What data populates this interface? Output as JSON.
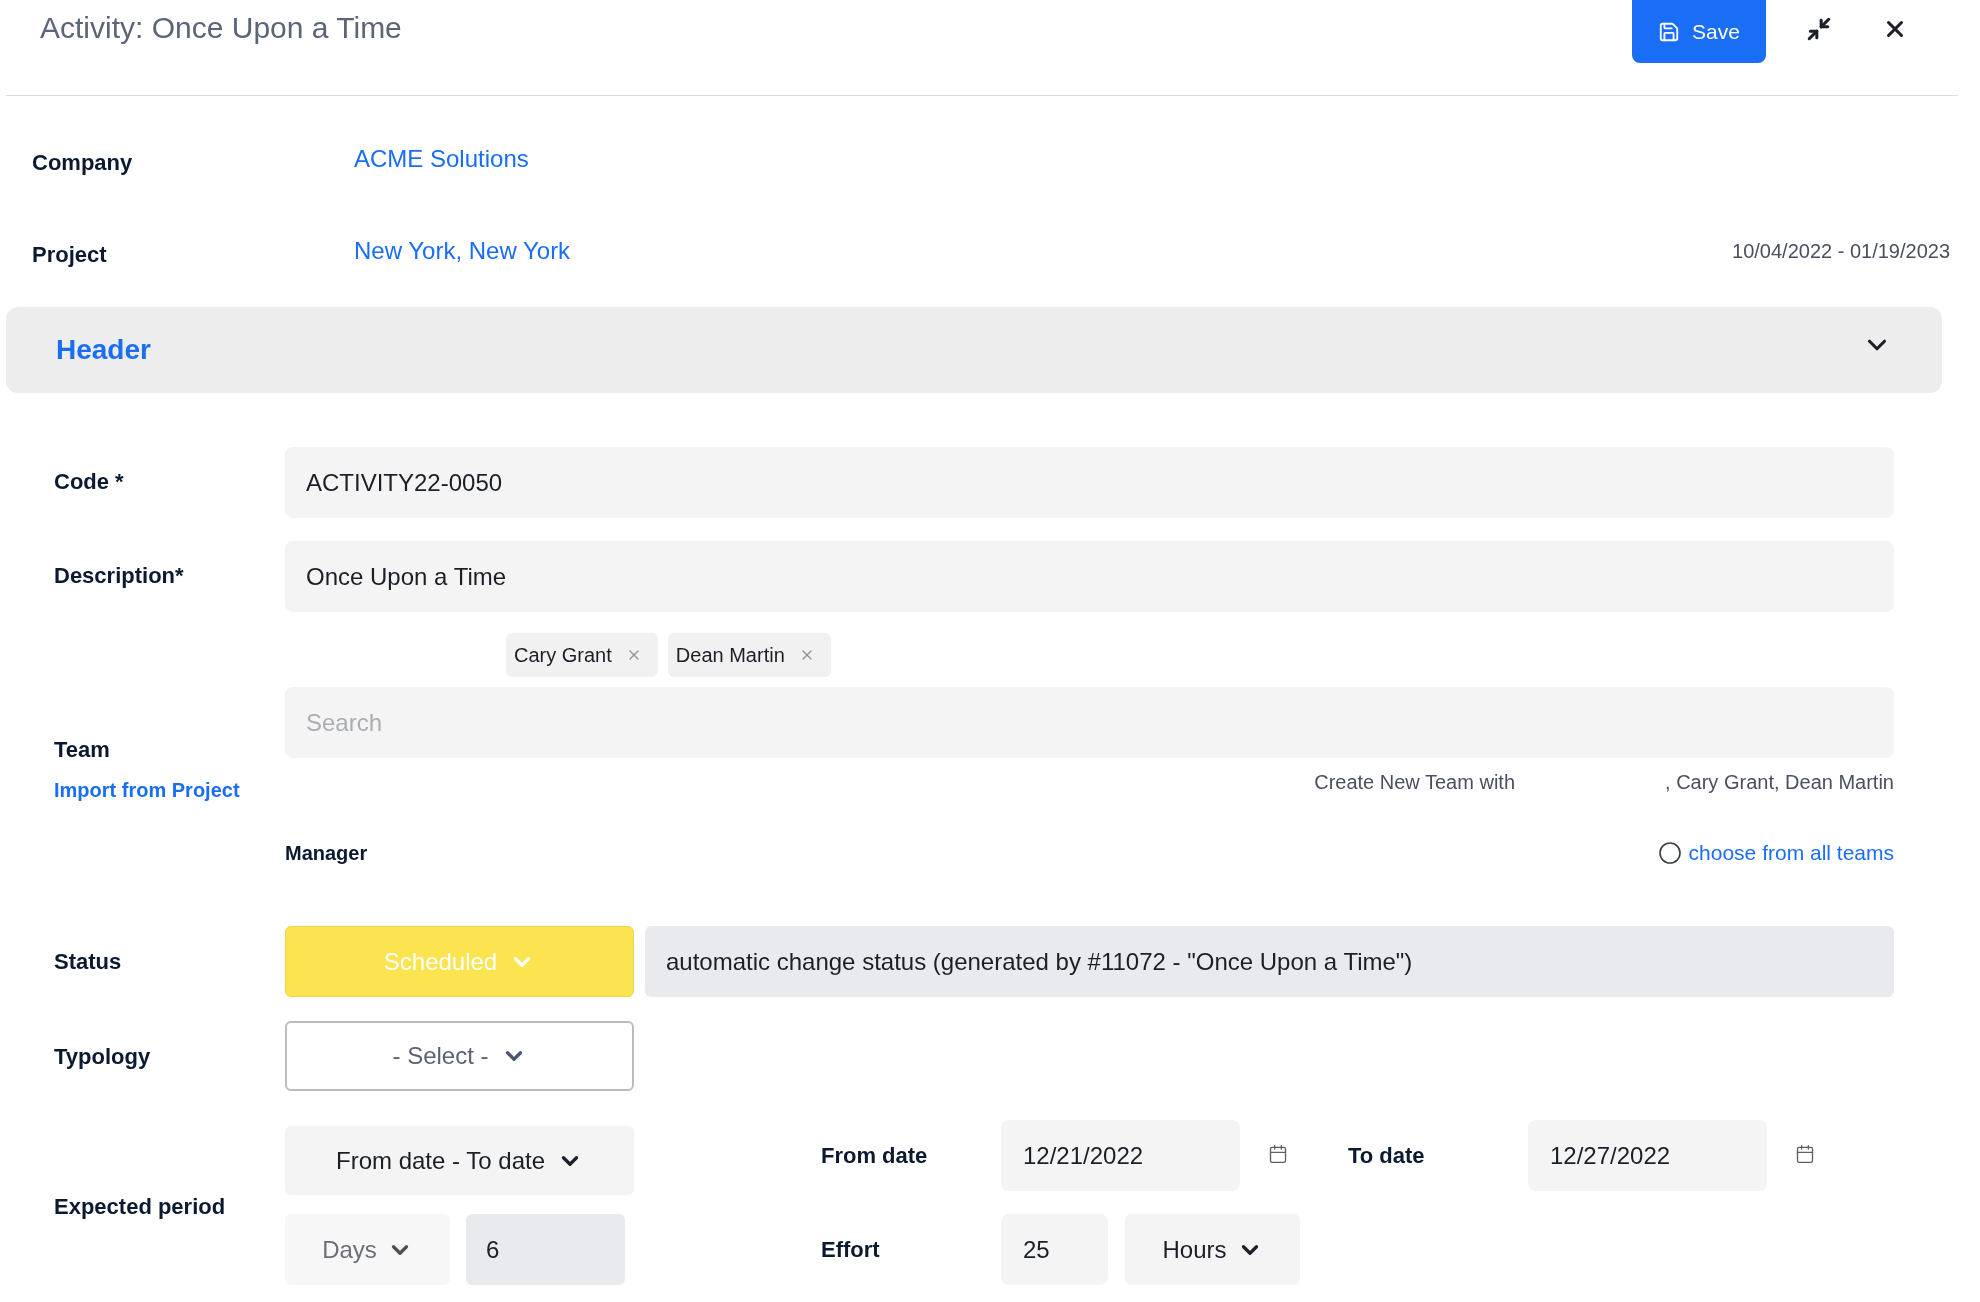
{
  "window": {
    "title": "Activity: Once Upon a Time"
  },
  "toolbar": {
    "save": "Save"
  },
  "company": {
    "label": "Company",
    "value": "ACME Solutions"
  },
  "project": {
    "label": "Project",
    "value": "New York, New York",
    "date_range": "10/04/2022 - 01/19/2023"
  },
  "section": {
    "title": "Header",
    "expanded": true
  },
  "code": {
    "label": "Code *",
    "value": "ACTIVITY22-0050"
  },
  "description": {
    "label": "Description*",
    "value": "Once Upon a Time"
  },
  "team": {
    "label": "Team",
    "import_link": "Import from Project",
    "members": [
      {
        "name": "Cary Grant"
      },
      {
        "name": "Dean Martin"
      }
    ],
    "search": {
      "placeholder": "Search"
    },
    "create_team": {
      "prefix": "Create New Team with",
      "suffix": ", Cary Grant, Dean Martin"
    },
    "manager": {
      "label": "Manager"
    },
    "all_teams_option": {
      "label": "choose from all teams",
      "selected": false
    }
  },
  "status": {
    "label": "Status",
    "value": "Scheduled",
    "note": "automatic change status (generated by #11072 - \"Once Upon a Time\")"
  },
  "typology": {
    "label": "Typology",
    "placeholder": "- Select -"
  },
  "expected_period": {
    "label": "Expected period",
    "mode": "From date - To date",
    "from_date": {
      "label": "From date",
      "value": "12/21/2022"
    },
    "to_date": {
      "label": "To date",
      "value": "12/27/2022"
    },
    "duration_unit": {
      "value": "Days",
      "disabled": true
    },
    "duration": "6",
    "effort": {
      "label": "Effort",
      "value": "25",
      "unit": "Hours"
    }
  }
}
